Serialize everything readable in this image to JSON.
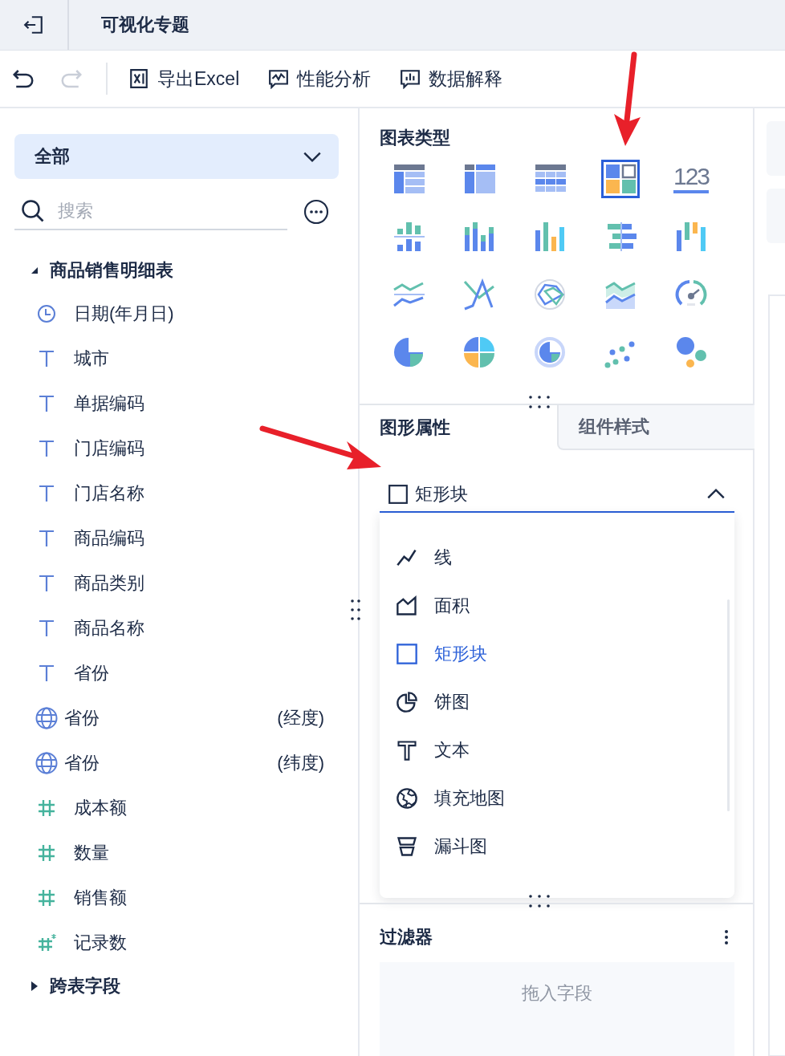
{
  "window": {
    "title": "可视化专题"
  },
  "toolbar": {
    "undo": {
      "disabled": false
    },
    "redo": {
      "disabled": true
    },
    "buttons": [
      {
        "kind": "excel",
        "label": "导出Excel"
      },
      {
        "kind": "performance",
        "label": "性能分析"
      },
      {
        "kind": "explain",
        "label": "数据解释"
      }
    ]
  },
  "sidebar": {
    "scope": "全部",
    "search": {
      "placeholder": "搜索"
    },
    "groups": [
      {
        "label": "商品销售明细表",
        "expanded": true,
        "children": [
          {
            "kind": "date",
            "label": "日期(年月日)"
          },
          {
            "kind": "text",
            "label": "城市"
          },
          {
            "kind": "text",
            "label": "单据编码"
          },
          {
            "kind": "text",
            "label": "门店编码"
          },
          {
            "kind": "text",
            "label": "门店名称"
          },
          {
            "kind": "text",
            "label": "商品编码"
          },
          {
            "kind": "text",
            "label": "商品类别"
          },
          {
            "kind": "text",
            "label": "商品名称"
          },
          {
            "kind": "text",
            "label": "省份"
          },
          {
            "kind": "geo",
            "label": "省份",
            "suffix": "(经度)"
          },
          {
            "kind": "geo",
            "label": "省份",
            "suffix": "(纬度)"
          },
          {
            "kind": "number",
            "label": "成本额"
          },
          {
            "kind": "number",
            "label": "数量"
          },
          {
            "kind": "number",
            "label": "销售额"
          },
          {
            "kind": "count",
            "label": "记录数"
          }
        ]
      },
      {
        "label": "跨表字段",
        "expanded": false
      }
    ]
  },
  "chart_types": {
    "title": "图表类型",
    "items": [
      {
        "kind": "table",
        "selected": false
      },
      {
        "kind": "cross-table",
        "selected": false
      },
      {
        "kind": "detail-table",
        "selected": false
      },
      {
        "kind": "rect-block",
        "selected": true
      },
      {
        "kind": "number",
        "label": "123",
        "selected": false
      },
      {
        "kind": "grouped-bar",
        "selected": false
      },
      {
        "kind": "stacked-bar",
        "selected": false
      },
      {
        "kind": "bar",
        "selected": false
      },
      {
        "kind": "diverging-bar",
        "selected": false
      },
      {
        "kind": "waterfall",
        "selected": false
      },
      {
        "kind": "dual-line",
        "selected": false
      },
      {
        "kind": "line",
        "selected": false
      },
      {
        "kind": "radar",
        "selected": false
      },
      {
        "kind": "area",
        "selected": false
      },
      {
        "kind": "gauge",
        "selected": false
      },
      {
        "kind": "pie",
        "selected": false
      },
      {
        "kind": "multi-pie",
        "selected": false
      },
      {
        "kind": "ring",
        "selected": false
      },
      {
        "kind": "scatter",
        "selected": false
      },
      {
        "kind": "bubble",
        "selected": false
      }
    ]
  },
  "property_tabs": [
    {
      "label": "图形属性",
      "selected": true
    },
    {
      "label": "组件样式",
      "selected": false
    }
  ],
  "shape_select": {
    "value": "矩形块",
    "kind": "rect",
    "expanded": true,
    "options": [
      {
        "kind": "line",
        "label": "线",
        "selected": false
      },
      {
        "kind": "area",
        "label": "面积",
        "selected": false
      },
      {
        "kind": "rect",
        "label": "矩形块",
        "selected": true
      },
      {
        "kind": "pie",
        "label": "饼图",
        "selected": false
      },
      {
        "kind": "text",
        "label": "文本",
        "selected": false
      },
      {
        "kind": "map",
        "label": "填充地图",
        "selected": false
      },
      {
        "kind": "funnel",
        "label": "漏斗图",
        "selected": false
      }
    ]
  },
  "filter": {
    "title": "过滤器",
    "dropzone": "拖入字段"
  }
}
